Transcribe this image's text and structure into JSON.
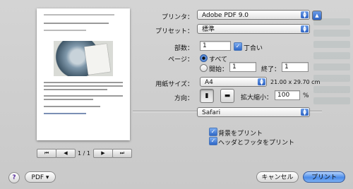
{
  "printer": {
    "label": "プリンタ：",
    "value": "Adobe PDF 9.0"
  },
  "preset": {
    "label": "プリセット：",
    "value": "標準"
  },
  "copies": {
    "label": "部数：",
    "value": "1",
    "collate_label": "丁合い"
  },
  "pages": {
    "label": "ページ：",
    "all_label": "すべて",
    "from_label": "開始：",
    "from_value": "1",
    "to_label": "終了：",
    "to_value": "1"
  },
  "paper": {
    "label": "用紙サイズ：",
    "value": "A4",
    "dimensions": "21.00 x 29.70 cm"
  },
  "orientation": {
    "label": "方向：",
    "scale_label": "拡大縮小：",
    "scale_value": "100",
    "scale_unit": "%"
  },
  "section": {
    "value": "Safari"
  },
  "options": {
    "print_backgrounds": "背景をプリント",
    "headers_footers": "ヘッダとフッタをプリント"
  },
  "preview": {
    "page_indicator": "1 / 1"
  },
  "buttons": {
    "help": "?",
    "pdf": "PDF ▾",
    "cancel": "キャンセル",
    "print": "プリント"
  },
  "icons": {
    "first": "⏮",
    "prev": "◀",
    "next": "▶",
    "last": "⏭",
    "up": "▲"
  }
}
